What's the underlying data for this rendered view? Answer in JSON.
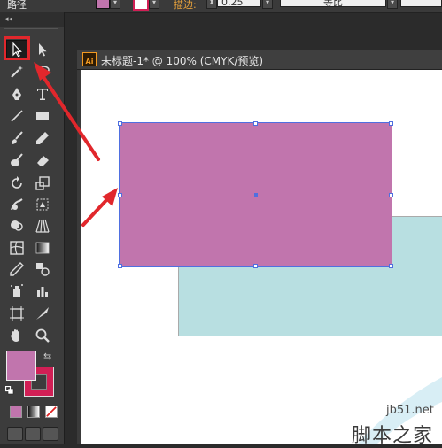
{
  "control_bar": {
    "panel_label": "路径",
    "stroke_label": "描边:",
    "stroke_value": "0.25",
    "style_value": "等比",
    "fill_color": "#c175ad",
    "stroke_color": "#d11f55"
  },
  "tools_panel": {
    "collapse_label": "◂◂",
    "selected_tool": "selection-tool",
    "fill_color": "#c175ad",
    "stroke_color": "#d11f55"
  },
  "document": {
    "tab_title": "未标题-1* @ 100% (CMYK/预览)",
    "app_icon_text": "Ai"
  },
  "artwork": {
    "front_rect_color": "#c175ad",
    "back_rect_color": "#b8dfe1",
    "selection_color": "#4f6fe0"
  },
  "annotations": {
    "highlight_color": "#e1272c"
  },
  "watermark": {
    "domain": "jb51.net",
    "site_name": "脚本之家"
  }
}
